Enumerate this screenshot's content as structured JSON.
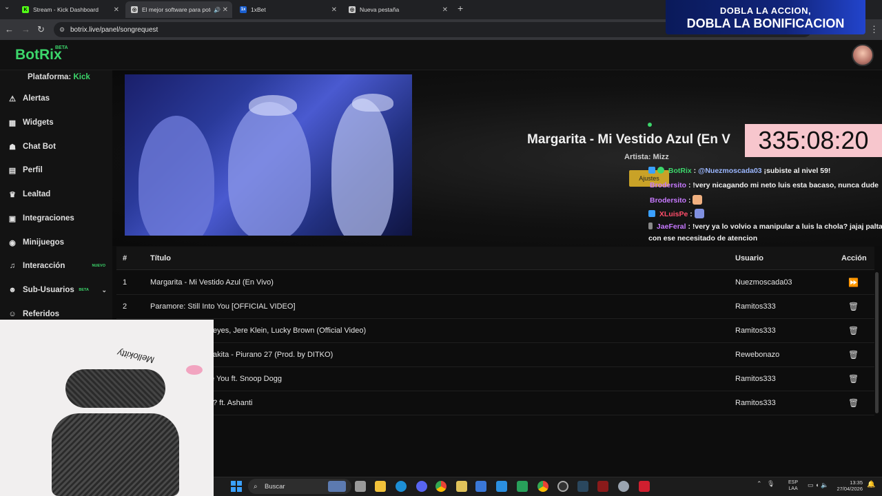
{
  "browser": {
    "tabs": [
      {
        "title": "Stream - Kick Dashboard",
        "icon": "kick-icon",
        "color": "#53fc18"
      },
      {
        "title": "El mejor software para pote",
        "icon": "chrome-tab-icon",
        "color": "#cccccc"
      },
      {
        "title": "1xBet",
        "icon": "1xbet-icon",
        "color": "#1a5fd0"
      },
      {
        "title": "Nueva pestaña",
        "icon": "globe-icon",
        "color": "#cccccc"
      }
    ],
    "url": "botrix.live/panel/songrequest"
  },
  "promo": {
    "line1": "DOBLA LA ACCION,",
    "line2": "DOBLA LA BONIFICACION"
  },
  "app": {
    "logo": "BotRix",
    "logo_badge": "BETA",
    "platform_label": "Plataforma:",
    "platform_value": "Kick"
  },
  "sidebar": {
    "items": [
      {
        "label": "Alertas",
        "icon": "warning-icon",
        "glyph": "⚠"
      },
      {
        "label": "Widgets",
        "icon": "grid-icon",
        "glyph": "▦"
      },
      {
        "label": "Chat Bot",
        "icon": "robot-icon",
        "glyph": "☗"
      },
      {
        "label": "Perfil",
        "icon": "id-card-icon",
        "glyph": "▤"
      },
      {
        "label": "Lealtad",
        "icon": "trophy-icon",
        "glyph": "♛"
      },
      {
        "label": "Integraciones",
        "icon": "puzzle-icon",
        "glyph": "▣"
      },
      {
        "label": "Minijuegos",
        "icon": "gamepad-icon",
        "glyph": "◉"
      },
      {
        "label": "Interacción",
        "icon": "music-icon",
        "glyph": "♫",
        "badge": "NUEVO"
      },
      {
        "label": "Sub-Usuarios",
        "icon": "users-icon",
        "glyph": "☻",
        "badge": "BETA"
      },
      {
        "label": "Referidos",
        "icon": "referral-icon",
        "glyph": "☺"
      }
    ]
  },
  "player": {
    "song_title": "Margarita - Mi Vestido Azul (En V",
    "artist_line": "Artista: Mizz",
    "timer": "335:08:20",
    "settings_label": "Ajustes"
  },
  "chat": [
    {
      "user": "BotRix",
      "user_color": "#3cd66b",
      "message": ": @Nuezmoscada03 ¡subiste al nivel 59!",
      "mention": "@Nuezmoscada03",
      "rest": " ¡subiste al nivel 59!",
      "icon_color": "#3aa0ff"
    },
    {
      "user": "Brodersito",
      "user_color": "#c779ff",
      "message": " : !very nicagando mi neto luis esta bacaso, nunca dude"
    },
    {
      "user": "Brodersito",
      "user_color": "#c779ff",
      "message": " :"
    },
    {
      "user": "XLuisPe",
      "user_color": "#ff4d6a",
      "message": " :"
    },
    {
      "user": "JaeFeral",
      "user_color": "#c779ff",
      "message": " : !very ya lo volvio a manipular a luis la chola? jajaj palta"
    },
    {
      "user": "",
      "user_color": "#ffffff",
      "message": "con ese necesitado de atencion"
    }
  ],
  "table": {
    "headers": {
      "num": "#",
      "title": "Título",
      "user": "Usuario",
      "action": "Acción"
    },
    "rows": [
      {
        "num": "1",
        "title": "Margarita - Mi Vestido Azul (En Vivo)",
        "user": "Nuezmoscada03",
        "action": "skip"
      },
      {
        "num": "2",
        "title": "Paramore: Still Into You [OFFICIAL VIDEO]",
        "user": "Ramitos333",
        "action": "delete"
      },
      {
        "num": "3",
        "title": "eyes, Jere Klein, Lucky Brown (Official Video)",
        "user": "Ramitos333",
        "action": "delete"
      },
      {
        "num": "4",
        "title": "akita - Piurano 27 (Prod. by DITKO)",
        "user": "Rewebonazo",
        "action": "delete"
      },
      {
        "num": "5",
        "title": "e You ft. Snoop Dogg",
        "user": "Ramitos333",
        "action": "delete"
      },
      {
        "num": "6",
        "title": "? ft. Ashanti",
        "user": "Ramitos333",
        "action": "delete"
      }
    ]
  },
  "webcam": {
    "sign_text": "Mellokitty"
  },
  "taskbar": {
    "search_label": "Buscar",
    "lang_line1": "ESP",
    "lang_line2": "LAA",
    "time": "13:35",
    "date": "27/04/2026"
  }
}
